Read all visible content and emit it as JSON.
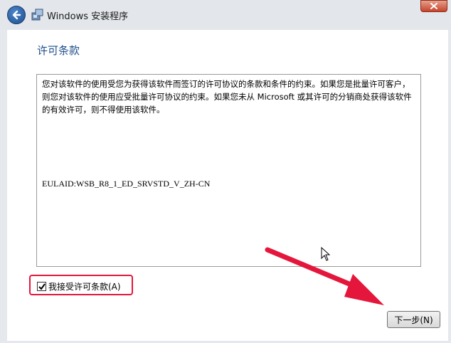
{
  "window": {
    "title": "Windows 安装程序"
  },
  "page": {
    "heading": "许可条款"
  },
  "license": {
    "text": "您对该软件的使用受您为获得该软件而签订的许可协议的条款和条件的约束。如果您是批量许可客户，则您对该软件的使用应受批量许可协议的约束。如果您未从 Microsoft 或其许可的分销商处获得该软件的有效许可，则不得使用该软件。",
    "eula_id": "EULAID:WSB_R8_1_ED_SRVSTD_V_ZH-CN"
  },
  "accept": {
    "label": "我接受许可条款(A)",
    "checked": true
  },
  "buttons": {
    "next": "下一步(N)"
  },
  "colors": {
    "heading": "#1f4e8c",
    "highlight": "#e5163b",
    "arrow": "#e5163b"
  }
}
